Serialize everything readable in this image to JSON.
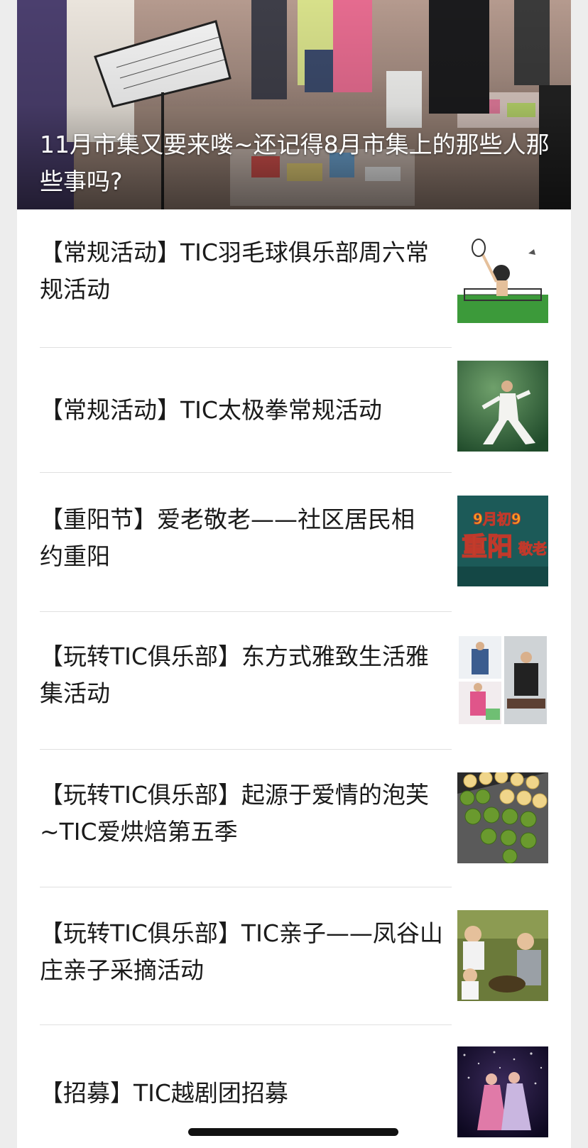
{
  "hero": {
    "title": "11月市集又要来喽~还记得8月市集上的那些人那些事吗?"
  },
  "articles": [
    {
      "title": "【常规活动】TIC羽毛球俱乐部周六常规活动",
      "thumb_icon": "badminton-illustration"
    },
    {
      "title": "【常规活动】TIC太极拳常规活动",
      "thumb_icon": "tai-chi-photo"
    },
    {
      "title": "【重阳节】爱老敬老——社区居民相约重阳",
      "thumb_icon": "double-ninth-poster",
      "thumb_text_1": "9月初9",
      "thumb_text_2": "重阳",
      "thumb_text_3": "敬老"
    },
    {
      "title": "【玩转TIC俱乐部】东方式雅致生活雅集活动",
      "thumb_icon": "elegant-life-collage"
    },
    {
      "title": "【玩转TIC俱乐部】起源于爱情的泡芙~TIC爱烘焙第五季",
      "thumb_icon": "cream-puffs-photo"
    },
    {
      "title": "【玩转TIC俱乐部】TIC亲子——凤谷山庄亲子采摘活动",
      "thumb_icon": "parent-child-picking-photo"
    },
    {
      "title": "【招募】TIC越剧团招募",
      "thumb_icon": "yue-opera-photo"
    }
  ],
  "colors": {
    "background": "#ededed",
    "card": "#ffffff",
    "text": "#1a1a1a",
    "divider": "#e0e0e0"
  }
}
